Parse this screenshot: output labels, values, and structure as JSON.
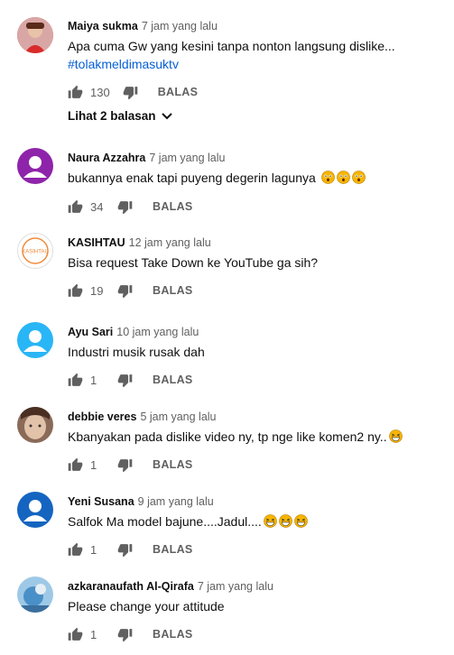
{
  "comments": [
    {
      "author": "Maiya sukma",
      "time": "7 jam yang lalu",
      "text": "Apa cuma Gw yang kesini tanpa nonton langsung dislike...",
      "hashtag": "#tolakmeldimasuktv",
      "likes": "130",
      "reply_label": "BALAS",
      "avatar": "photo-red",
      "replies_link": "Lihat 2 balasan"
    },
    {
      "author": "Naura Azzahra",
      "time": "7 jam yang lalu",
      "text": "bukannya enak tapi puyeng degerin lagunya",
      "likes": "34",
      "reply_label": "BALAS",
      "avatar": "default-purple",
      "emoji": "astonished-face-emoji"
    },
    {
      "author": "KASIHTAU",
      "time": "12 jam yang lalu",
      "text": "Bisa request Take Down ke YouTube ga sih?",
      "likes": "19",
      "reply_label": "BALAS",
      "avatar": "logo-kasihtau",
      "avatar_text": "KASIHTAU"
    },
    {
      "author": "Ayu Sari",
      "time": "10 jam yang lalu",
      "text": "Industri musik rusak dah",
      "likes": "1",
      "reply_label": "BALAS",
      "avatar": "default-blue"
    },
    {
      "author": "debbie veres",
      "time": "5 jam yang lalu",
      "text": "Kbanyakan pada dislike video ny, tp nge like komen2 ny..",
      "likes": "1",
      "reply_label": "BALAS",
      "avatar": "photo-face",
      "emoji": "grinning-squint-face-emoji"
    },
    {
      "author": "Yeni Susana",
      "time": "9 jam yang lalu",
      "text": "Salfok Ma model bajune....Jadul....",
      "likes": "1",
      "reply_label": "BALAS",
      "avatar": "default-navy",
      "emoji": "grinning-squint-face-emoji"
    },
    {
      "author": "azkaranaufath Al-Qirafa",
      "time": "7 jam yang lalu",
      "text": "Please change your attitude",
      "likes": "1",
      "reply_label": "BALAS",
      "avatar": "photo-blue"
    }
  ],
  "colors": {
    "link": "#065fd4",
    "muted": "#606060",
    "text": "#0f0f0f",
    "purple": "#8e24aa",
    "blue": "#29b6f6",
    "navy": "#1565c0"
  }
}
